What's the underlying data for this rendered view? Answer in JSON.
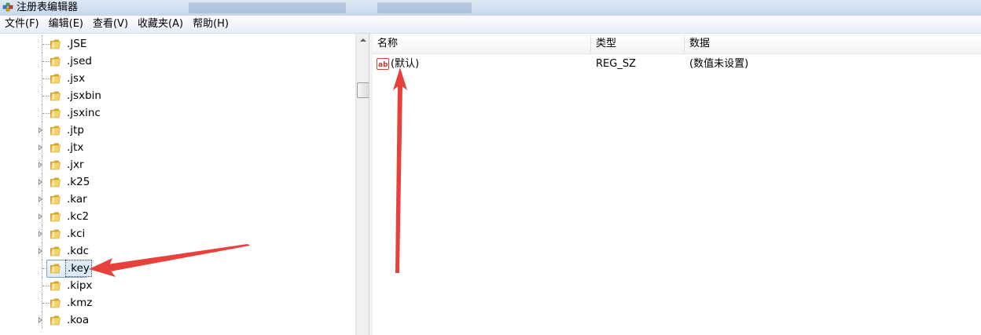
{
  "window": {
    "title": "注册表编辑器"
  },
  "menu": [
    "文件(F)",
    "编辑(E)",
    "查看(V)",
    "收藏夹(A)",
    "帮助(H)"
  ],
  "tree": [
    {
      "label": ".JSE",
      "expandable": false
    },
    {
      "label": ".jsed",
      "expandable": false
    },
    {
      "label": ".jsx",
      "expandable": false
    },
    {
      "label": ".jsxbin",
      "expandable": false
    },
    {
      "label": ".jsxinc",
      "expandable": false
    },
    {
      "label": ".jtp",
      "expandable": true
    },
    {
      "label": ".jtx",
      "expandable": true
    },
    {
      "label": ".jxr",
      "expandable": true
    },
    {
      "label": ".k25",
      "expandable": true
    },
    {
      "label": ".kar",
      "expandable": true
    },
    {
      "label": ".kc2",
      "expandable": true
    },
    {
      "label": ".kci",
      "expandable": true
    },
    {
      "label": ".kdc",
      "expandable": true
    },
    {
      "label": ".key",
      "expandable": false,
      "selected": true
    },
    {
      "label": ".kipx",
      "expandable": false
    },
    {
      "label": ".kmz",
      "expandable": false
    },
    {
      "label": ".koa",
      "expandable": true
    }
  ],
  "list": {
    "columns": {
      "name": "名称",
      "type": "类型",
      "data": "数据"
    },
    "rows": [
      {
        "name": "(默认)",
        "type": "REG_SZ",
        "data": "(数值未设置)"
      }
    ]
  },
  "colors": {
    "annotation": "#e8403a",
    "selection": "#dbe9f8",
    "titlebar": "#c6d7ec"
  }
}
